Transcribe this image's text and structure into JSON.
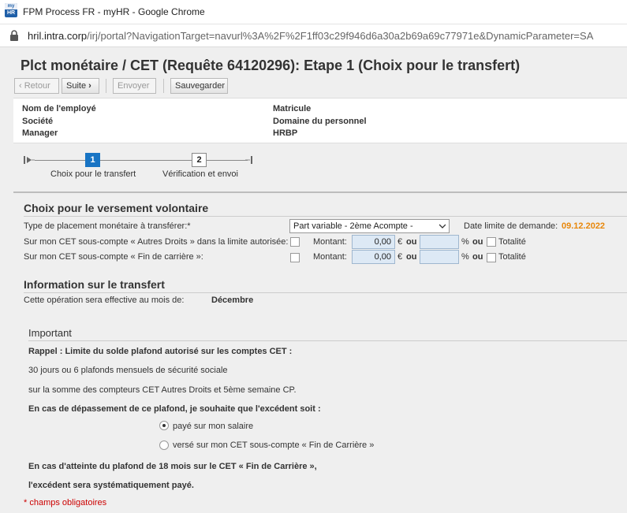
{
  "browser": {
    "window_title": "FPM Process FR - myHR - Google Chrome",
    "logo": {
      "top": "my",
      "bottom": "HR"
    },
    "url_host": "hril.intra.corp",
    "url_path": "/irj/portal?NavigationTarget=navurl%3A%2F%2F1ff03c29f946d6a30a2b69a69c77971e&DynamicParameter=SA"
  },
  "page": {
    "title": "Plct monétaire / CET (Requête 64120296): Etape 1  (Choix pour le transfert)"
  },
  "toolbar": {
    "back_label": "Retour",
    "back_icon": "chevron-left-icon",
    "next_label": "Suite",
    "next_icon": "chevron-right-icon",
    "send_label": "Envoyer",
    "save_label": "Sauvegarder"
  },
  "header": {
    "employee_name": "Nom de l'employé",
    "company": "Société",
    "manager": "Manager",
    "matricule": "Matricule",
    "domain": "Domaine du personnel",
    "hrbp": "HRBP"
  },
  "roadmap": {
    "steps": [
      {
        "number": "1",
        "label": "Choix pour le transfert",
        "active": true
      },
      {
        "number": "2",
        "label": "Vérification et envoi",
        "active": false
      }
    ]
  },
  "choice": {
    "title": "Choix pour le versement volontaire",
    "type_label": "Type de placement monétaire à transférer:",
    "required_mark": "*",
    "type_value": "Part variable - 2ème Acompte -",
    "deadline_label": "Date limite de demande:",
    "deadline_value": "09.12.2022",
    "rows": [
      {
        "label": "Sur mon CET sous-compte « Autres Droits » dans la limite autorisée:",
        "amount_label": "Montant:",
        "amount_value": "0,00",
        "currency": "€",
        "or1": "ou",
        "percent": "%",
        "or2": "ou",
        "total_label": "Totalité"
      },
      {
        "label": "Sur mon CET sous-compte « Fin de carrière »:",
        "amount_label": "Montant:",
        "amount_value": "0,00",
        "currency": "€",
        "or1": "ou",
        "percent": "%",
        "or2": "ou",
        "total_label": "Totalité"
      }
    ]
  },
  "transfer": {
    "title": "Information sur le transfert",
    "effective_label": "Cette opération sera effective au mois de:",
    "effective_value": "Décembre"
  },
  "important": {
    "title": "Important",
    "line1": "Rappel : Limite du solde plafond autorisé sur les comptes CET :",
    "line2": "30 jours ou 6 plafonds mensuels de sécurité sociale",
    "line3": "sur la somme des compteurs CET Autres Droits et 5ème semaine CP.",
    "line4": "En cas de dépassement de ce plafond, je souhaite que l'excédent soit :",
    "option1": "payé sur mon salaire",
    "option2": "versé sur mon CET sous-compte « Fin de Carrière »",
    "line5": "En cas d'atteinte du plafond de 18 mois sur le CET « Fin de Carrière »,",
    "line6": "l'excédent sera systématiquement payé.",
    "required_note": "* champs obligatoires"
  },
  "colors": {
    "accent": "#1874c4",
    "deadline": "#e8870a",
    "required": "#cc0000",
    "input_bg": "#dde9f5"
  }
}
